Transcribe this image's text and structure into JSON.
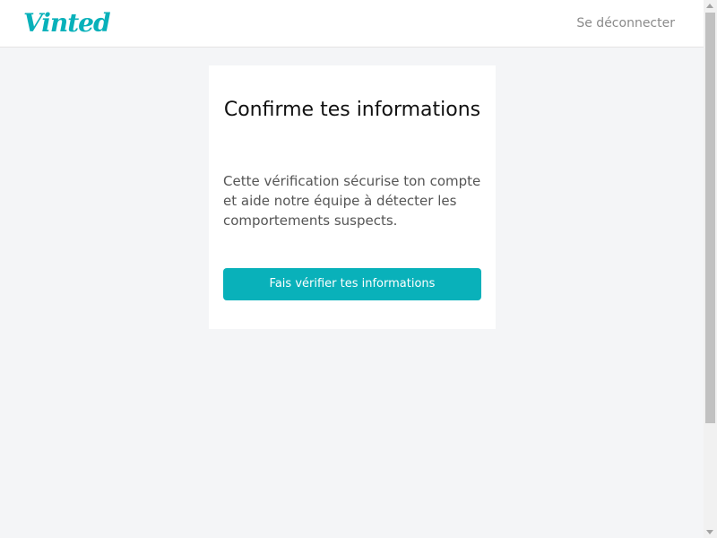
{
  "header": {
    "logo_text": "Vinted",
    "logout_label": "Se déconnecter"
  },
  "card": {
    "title": "Confirme tes informations",
    "description": "Cette vérification sécurise ton compte et aide notre équipe à détecter les comportements suspects.",
    "button_label": "Fais vérifier tes informations"
  },
  "colors": {
    "brand": "#09b1ba",
    "background": "#f4f5f7",
    "card": "#ffffff",
    "muted_text": "#8a8a8a"
  },
  "icons": {
    "scroll_up": "chevron-up-icon",
    "scroll_down": "chevron-down-icon"
  }
}
